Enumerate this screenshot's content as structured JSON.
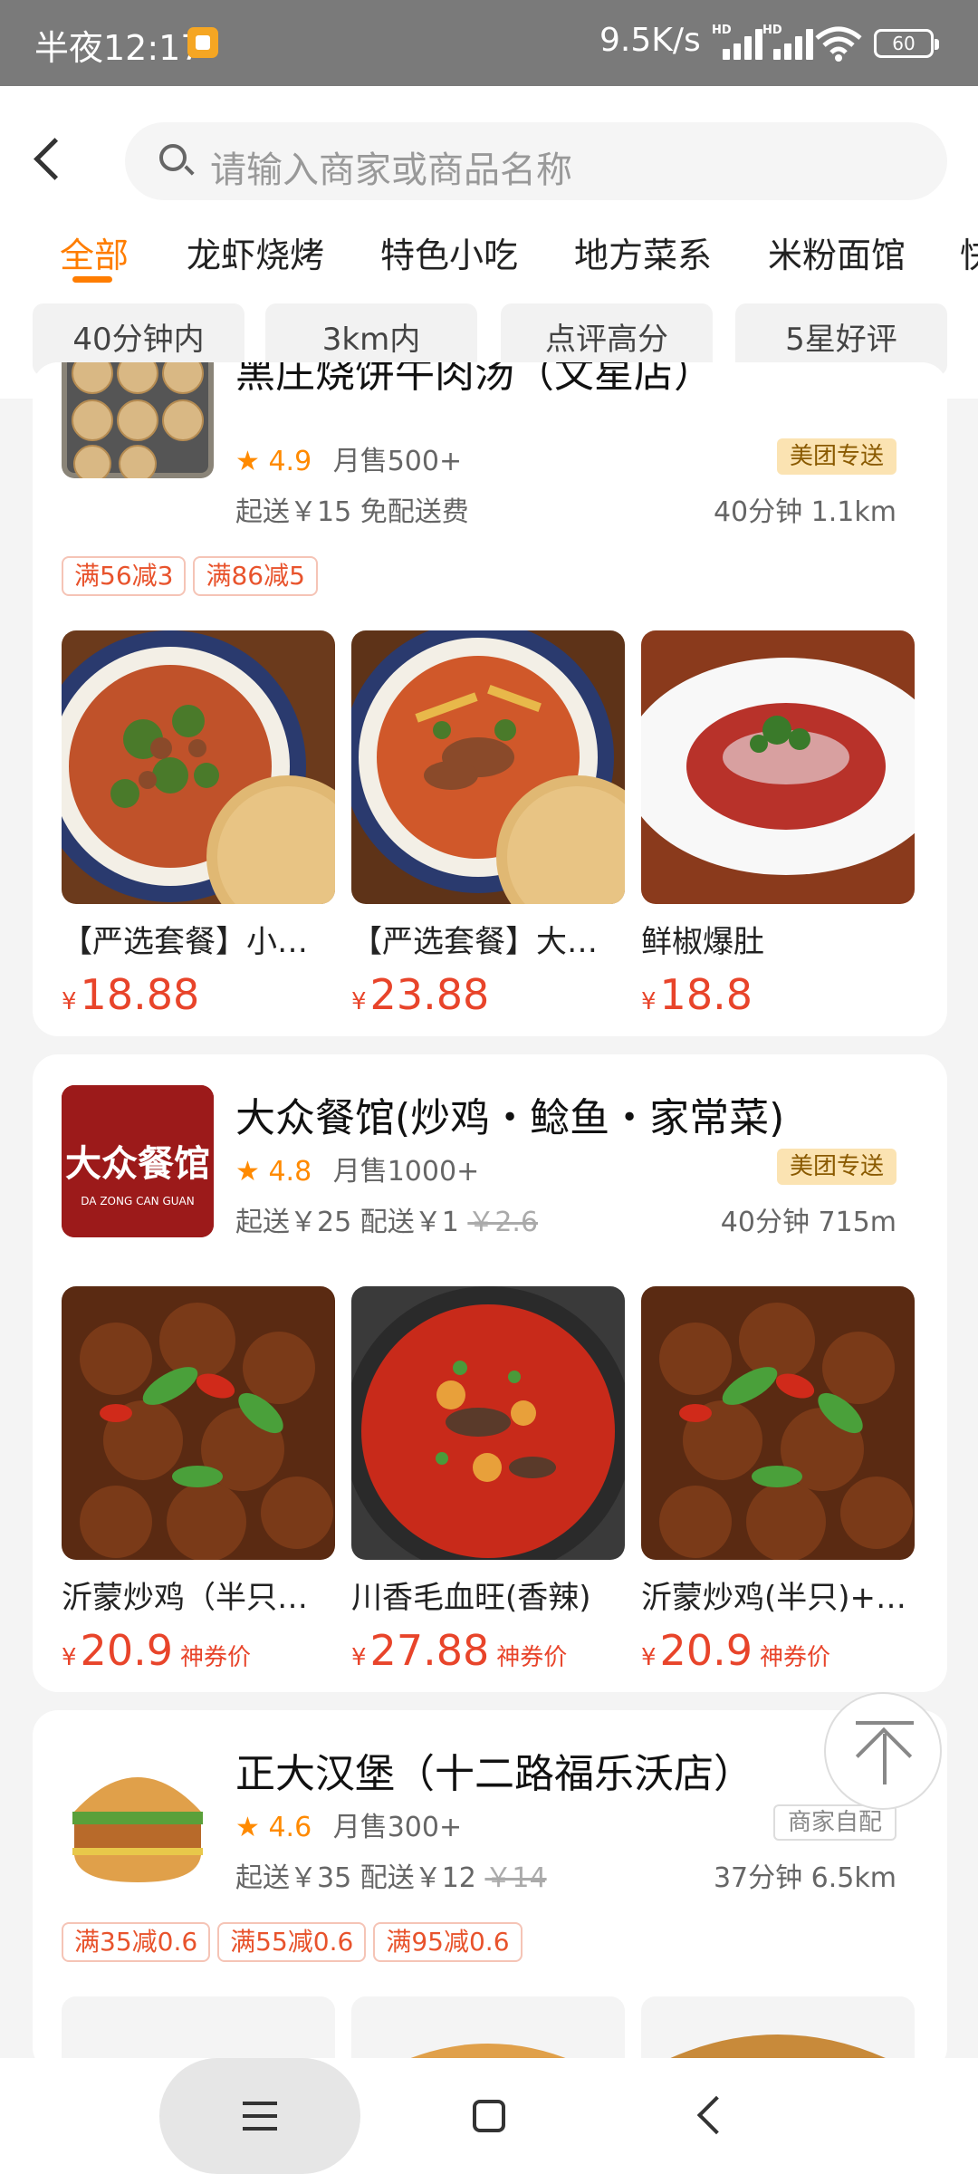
{
  "status_bar": {
    "time": "半夜12:17",
    "speed": "9.5K/s",
    "signal1_label": "HD",
    "signal2_label": "HD",
    "battery": "60"
  },
  "search": {
    "placeholder": "请输入商家或商品名称"
  },
  "tabs": [
    {
      "label": "全部",
      "active": true
    },
    {
      "label": "龙虾烧烤"
    },
    {
      "label": "特色小吃"
    },
    {
      "label": "地方菜系"
    },
    {
      "label": "米粉面馆"
    },
    {
      "label": "快"
    }
  ],
  "filters": [
    "40分钟内",
    "3km内",
    "点评高分",
    "5星好评"
  ],
  "shops": [
    {
      "name": "黑庄烧饼牛肉汤（文星店）",
      "rating": "4.9",
      "sales": "月售500+",
      "delivery_badge": "美团专送",
      "min_order": "起送￥15 免配送费",
      "time_distance": "40分钟 1.1km",
      "promos": [
        "满56减3",
        "满86减5"
      ],
      "dishes": [
        {
          "name": "【严选套餐】小…",
          "currency": "¥",
          "price": "18.88"
        },
        {
          "name": "【严选套餐】大…",
          "currency": "¥",
          "price": "23.88"
        },
        {
          "name": "鲜椒爆肚",
          "currency": "¥",
          "price": "18.8"
        }
      ]
    },
    {
      "name": "大众餐馆(炒鸡・鲶鱼・家常菜)",
      "rating": "4.8",
      "sales": "月售1000+",
      "delivery_badge": "美团专送",
      "min_order": "起送￥25 配送￥1",
      "original_fee": "￥2.6",
      "time_distance": "40分钟 715m",
      "logo_text": "大众餐馆",
      "logo_subtext": "DA ZONG CAN GUAN",
      "dishes": [
        {
          "name": "沂蒙炒鸡（半只…",
          "currency": "¥",
          "price": "20.9",
          "tag": "神券价"
        },
        {
          "name": "川香毛血旺(香辣)",
          "currency": "¥",
          "price": "27.88",
          "tag": "神券价"
        },
        {
          "name": "沂蒙炒鸡(半只)+…",
          "currency": "¥",
          "price": "20.9",
          "tag": "神券价"
        }
      ]
    },
    {
      "name": "正大汉堡（十二路福乐沃店）",
      "rating": "4.6",
      "sales": "月售300+",
      "delivery_badge": "商家自配",
      "min_order": "起送￥35 配送￥12",
      "original_fee": "￥14",
      "time_distance": "37分钟 6.5km",
      "promos": [
        "满35减0.6",
        "满55减0.6",
        "满95减0.6"
      ]
    }
  ],
  "colors": {
    "accent": "#ff7d00",
    "price": "#e8442a",
    "badge_bg": "#fbe3b2"
  }
}
